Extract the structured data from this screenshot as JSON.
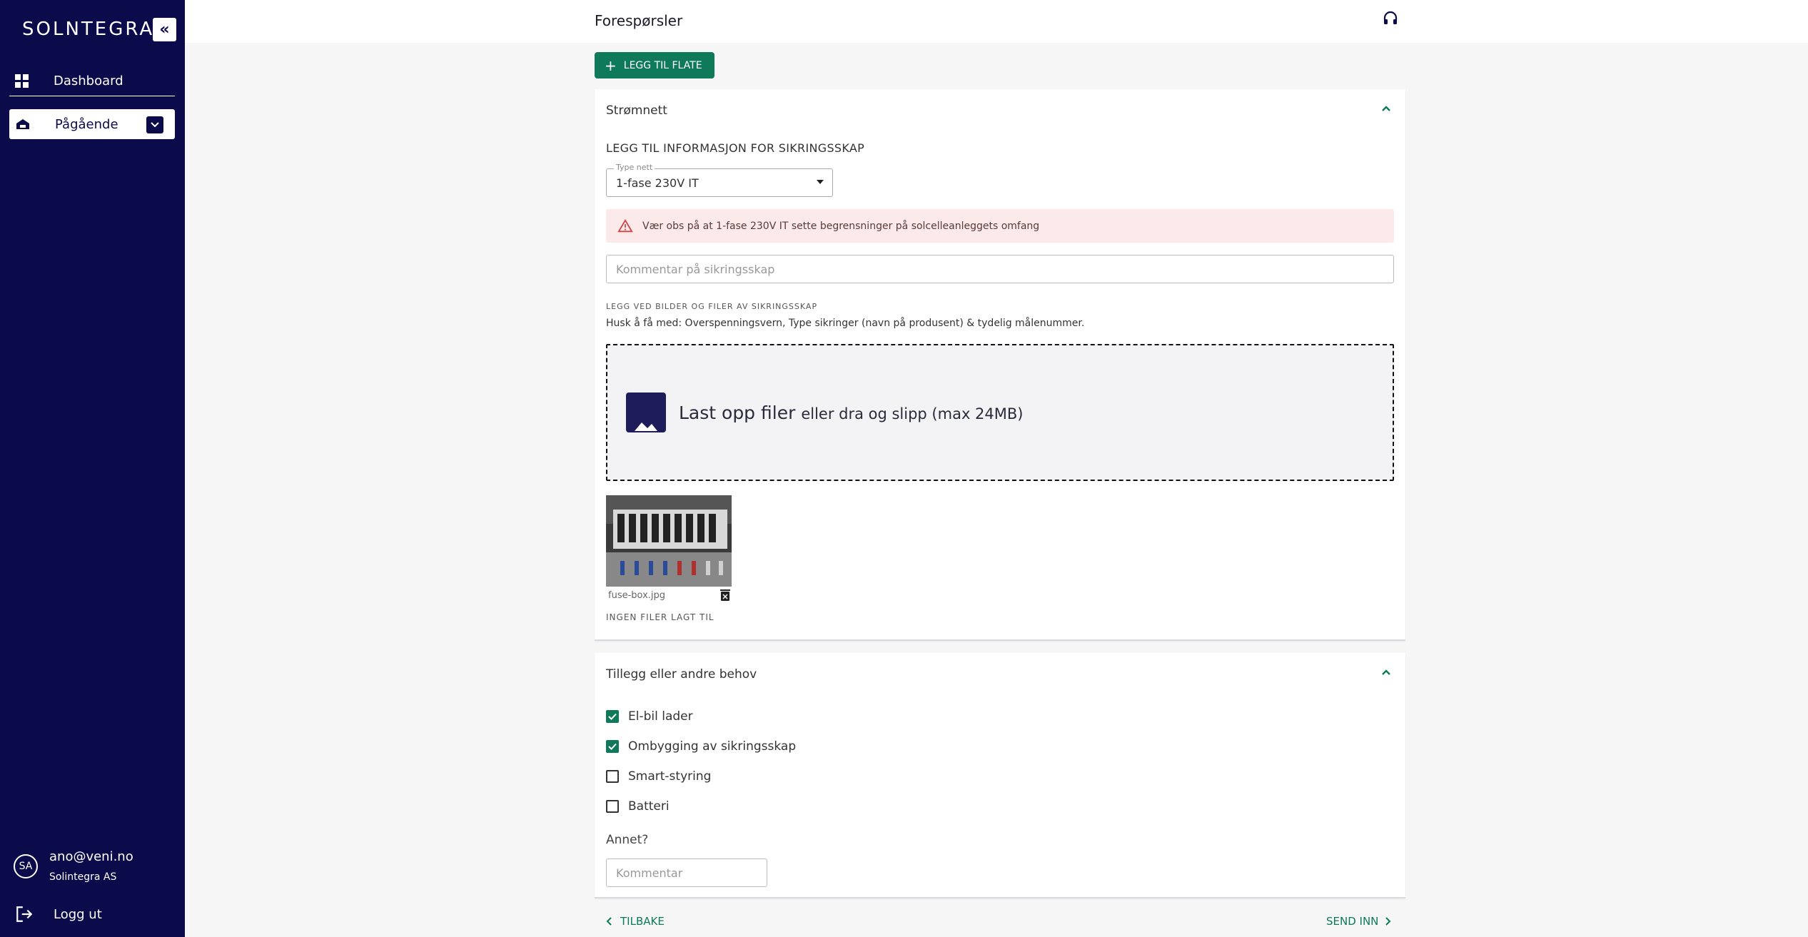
{
  "sidebar": {
    "logo": "SOLNTEGRA",
    "collapse_icon": "double-chevron-left-icon",
    "items": [
      {
        "label": "Dashboard",
        "icon": "dashboard-icon"
      },
      {
        "label": "Pågående",
        "icon": "house-icon",
        "expand_icon": "chevron-down-icon"
      }
    ],
    "user": {
      "initials": "SA",
      "email": "ano@veni.no",
      "company": "Solintegra AS"
    },
    "logout_label": "Logg ut"
  },
  "header": {
    "title": "Forespørsler",
    "support_icon": "headset-icon"
  },
  "main": {
    "add_surface_label": "LEGG TIL FLATE",
    "power_card": {
      "title": "Strømnett",
      "section_title": "LEGG TIL INFORMASJON FOR SIKRINGSSKAP",
      "grid_type": {
        "label": "Type nett",
        "value": "1-fase 230V IT"
      },
      "warning": "Vær obs på at 1-fase 230V IT sette begrensninger på solcelleanleggets omfang",
      "comment_placeholder": "Kommentar på sikringsskap",
      "files_heading": "LEGG VED BILDER OG FILER AV SIKRINGSSKAP",
      "files_hint": "Husk å få med: Overspenningsvern, Type sikringer (navn på produsent) & tydelig målenummer.",
      "upload_main": "Last opp filer",
      "upload_sub": "eller dra og slipp (max 24MB)",
      "uploaded_file": "fuse-box.jpg",
      "no_files_text": "INGEN FILER LAGT TIL"
    },
    "extras_card": {
      "title": "Tillegg eller andre behov",
      "options": [
        {
          "label": "El-bil lader",
          "checked": true
        },
        {
          "label": "Ombygging av sikringsskap",
          "checked": true
        },
        {
          "label": "Smart-styring",
          "checked": false
        },
        {
          "label": "Batteri",
          "checked": false
        }
      ],
      "other_label": "Annet?",
      "other_placeholder": "Kommentar"
    },
    "back_label": "TILBAKE",
    "submit_label": "SEND INN"
  },
  "colors": {
    "sidebar_bg": "#0b0a4a",
    "accent": "#0e7a5a",
    "warning_bg": "#fce9e9"
  }
}
